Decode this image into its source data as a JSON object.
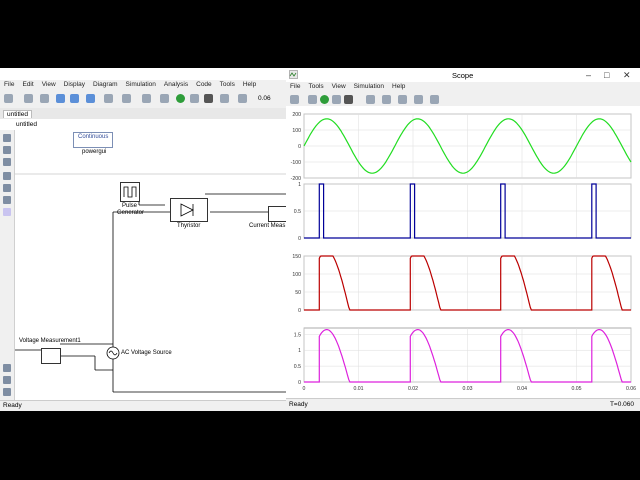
{
  "simulink": {
    "menu": [
      "File",
      "Edit",
      "View",
      "Display",
      "Diagram",
      "Simulation",
      "Analysis",
      "Code",
      "Tools",
      "Help"
    ],
    "sim_time": "0.06",
    "tab": "untitled",
    "breadcrumb": "untitled",
    "status": "Ready",
    "blocks": {
      "continuous": "Continuous",
      "powergui": "powergui",
      "pulse_generator_l1": "Pulse",
      "pulse_generator_l2": "Generator",
      "thyristor": "Thyristor",
      "current_meas": "Current Meas",
      "voltage_meas": "Voltage Measurement1",
      "ac_source": "AC Voltage Source"
    }
  },
  "scope": {
    "title": "Scope",
    "menu": [
      "File",
      "Tools",
      "View",
      "Simulation",
      "Help"
    ],
    "status_left": "Ready",
    "status_right": "T=0.060",
    "colors": {
      "plot1": "#22dd22",
      "plot2": "#000099",
      "plot3": "#bb0000",
      "plot4": "#dd22dd"
    }
  },
  "chart_data": {
    "type": "line",
    "xlim": [
      0,
      0.06
    ],
    "xticks": [
      "0",
      "0.01",
      "0.02",
      "0.03",
      "0.04",
      "0.05",
      "0.06"
    ],
    "grid": true,
    "panels": [
      {
        "name": "",
        "ylim": [
          -200,
          200
        ],
        "yticks": [
          "200",
          "100",
          "0",
          "-100",
          "-200"
        ],
        "series": {
          "x": [
            0,
            0.0041667,
            0.0125,
            0.0208333,
            0.0291667,
            0.0375,
            0.0458333,
            0.0541667,
            0.06
          ],
          "y": [
            0,
            170,
            -170,
            170,
            -170,
            170,
            -170,
            170,
            0
          ],
          "kind": "sine",
          "amplitude": 170,
          "period": 0.016667,
          "phase": 0
        }
      },
      {
        "name": "",
        "ylim": [
          0,
          1
        ],
        "yticks": [
          "1",
          "0.5",
          "0"
        ],
        "series": {
          "kind": "pulse",
          "x": [
            0,
            0.0028,
            0.0028,
            0.0036,
            0.0036,
            0.0195,
            0.0195,
            0.0203,
            0.0203,
            0.0361,
            0.0361,
            0.0369,
            0.0369,
            0.0528,
            0.0528,
            0.0536,
            0.0536,
            0.06
          ],
          "y": [
            0,
            0,
            1,
            1,
            0,
            0,
            1,
            1,
            0,
            0,
            1,
            1,
            0,
            0,
            1,
            1,
            0,
            0
          ]
        }
      },
      {
        "name": "",
        "ylim": [
          0,
          150
        ],
        "yticks": [
          "150",
          "100",
          "50",
          "0"
        ],
        "series": {
          "kind": "rectified",
          "peak": 165,
          "starts": [
            0.0028,
            0.0195,
            0.0361,
            0.0528
          ],
          "period": 0.016667
        }
      },
      {
        "name": "",
        "ylim": [
          0,
          1.7
        ],
        "yticks": [
          "1.5",
          "1",
          "0.5",
          "0"
        ],
        "series": {
          "kind": "rectified",
          "peak": 1.65,
          "starts": [
            0.0028,
            0.0195,
            0.0361,
            0.0528
          ],
          "period": 0.016667
        }
      }
    ]
  }
}
